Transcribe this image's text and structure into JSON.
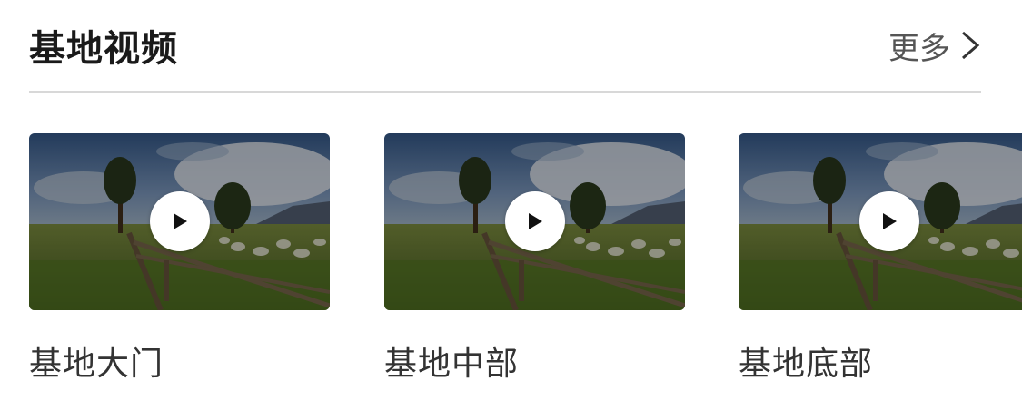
{
  "section": {
    "title": "基地视频",
    "more_label": "更多"
  },
  "videos": [
    {
      "title": "基地大门"
    },
    {
      "title": "基地中部"
    },
    {
      "title": "基地底部"
    }
  ],
  "icons": {
    "more": "chevron-right-icon",
    "play": "play-icon"
  }
}
